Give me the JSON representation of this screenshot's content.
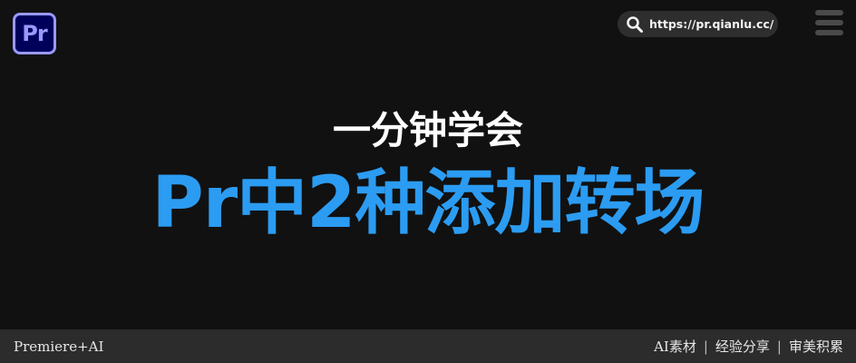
{
  "header": {
    "logo_text": "Pr",
    "url": "https://pr.qianlu.cc/",
    "icons": [
      "search-icon",
      "menu-icon"
    ]
  },
  "main": {
    "subtitle": "一分钟学会",
    "title": "Pr中2种添加转场"
  },
  "footer": {
    "left": "Premiere+AI",
    "right_items": [
      "AI素材",
      "经验分享",
      "审美积累"
    ],
    "separator": "|"
  },
  "colors": {
    "background": "#111111",
    "title_blue": "#2b9cf2",
    "logo_purple": "#9999ff",
    "logo_bg": "#00005b",
    "footer_bg": "#2c2c2c"
  }
}
